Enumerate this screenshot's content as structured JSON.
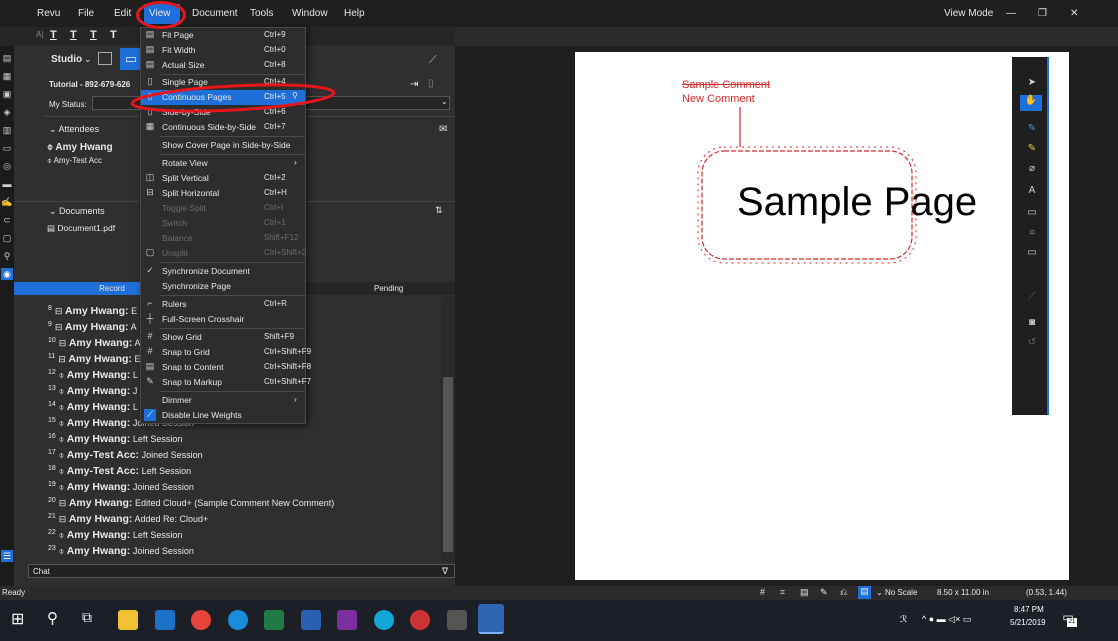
{
  "menubar": {
    "items": [
      "Revu",
      "File",
      "Edit",
      "View",
      "Document",
      "Tools",
      "Window",
      "Help"
    ],
    "view_mode": "View Mode"
  },
  "toolbar": {
    "studio_label": "Studio"
  },
  "session": {
    "id": "Tutorial - 892-679-626",
    "status_label": "My Status:"
  },
  "attendees": {
    "header": "Attendees",
    "names": [
      "Amy Hwang",
      "Amy-Test Acc"
    ]
  },
  "documents": {
    "header": "Documents",
    "items": [
      "Document1.pdf"
    ]
  },
  "record_tabs": {
    "record": "Record",
    "pending": "Pending"
  },
  "log": [
    {
      "n": "8",
      "name": "Amy Hwang:",
      "text": "E"
    },
    {
      "n": "9",
      "name": "Amy Hwang:",
      "text": "A"
    },
    {
      "n": "10",
      "name": "Amy Hwang:",
      "text": "A"
    },
    {
      "n": "11",
      "name": "Amy Hwang:",
      "text": "E"
    },
    {
      "n": "12",
      "name": "Amy Hwang:",
      "text": "L"
    },
    {
      "n": "13",
      "name": "Amy Hwang:",
      "text": "J"
    },
    {
      "n": "14",
      "name": "Amy Hwang:",
      "text": "L"
    },
    {
      "n": "15",
      "name": "Amy Hwang:",
      "text": "Joined Session"
    },
    {
      "n": "16",
      "name": "Amy Hwang:",
      "text": "Left Session"
    },
    {
      "n": "17",
      "name": "Amy-Test Acc:",
      "text": "Joined Session"
    },
    {
      "n": "18",
      "name": "Amy-Test Acc:",
      "text": "Left Session"
    },
    {
      "n": "19",
      "name": "Amy Hwang:",
      "text": "Joined Session"
    },
    {
      "n": "20",
      "name": "Amy Hwang:",
      "text": "Edited Cloud+ (Sample Comment New Comment)"
    },
    {
      "n": "21",
      "name": "Amy Hwang:",
      "text": "Added Re: Cloud+"
    },
    {
      "n": "22",
      "name": "Amy Hwang:",
      "text": "Left Session"
    },
    {
      "n": "23",
      "name": "Amy Hwang:",
      "text": "Joined Session"
    }
  ],
  "chat": {
    "label": "Chat"
  },
  "view_menu": [
    {
      "label": "Fit Page",
      "shortcut": "Ctrl+9",
      "icon": "fit-page-icon"
    },
    {
      "label": "Fit Width",
      "shortcut": "Ctrl+0",
      "icon": "fit-width-icon"
    },
    {
      "label": "Actual Size",
      "shortcut": "Ctrl+8",
      "icon": "actual-size-icon"
    },
    {
      "label": "Single Page",
      "shortcut": "Ctrl+4",
      "icon": "single-page-icon"
    },
    {
      "label": "Continuous Pages",
      "shortcut": "Ctrl+5",
      "icon": "continuous-pages-icon"
    },
    {
      "label": "Side-by-Side",
      "shortcut": "Ctrl+6",
      "icon": "side-by-side-icon"
    },
    {
      "label": "Continuous Side-by-Side",
      "shortcut": "Ctrl+7",
      "icon": "continuous-side-by-side-icon"
    },
    {
      "label": "Show Cover Page in Side-by-Side",
      "shortcut": "",
      "icon": ""
    },
    {
      "label": "Rotate View",
      "shortcut": "",
      "icon": ""
    },
    {
      "label": "Split Vertical",
      "shortcut": "Ctrl+2",
      "icon": "split-vertical-icon"
    },
    {
      "label": "Split Horizontal",
      "shortcut": "Ctrl+H",
      "icon": "split-horizontal-icon"
    },
    {
      "label": "Toggle Split",
      "shortcut": "Ctrl+I",
      "icon": ""
    },
    {
      "label": "Switch",
      "shortcut": "Ctrl+1",
      "icon": ""
    },
    {
      "label": "Balance",
      "shortcut": "Shift+F12",
      "icon": ""
    },
    {
      "label": "Unsplit",
      "shortcut": "Ctrl+Shift+2",
      "icon": "unsplit-icon"
    },
    {
      "label": "Synchronize Document",
      "shortcut": "",
      "icon": "check-icon"
    },
    {
      "label": "Synchronize Page",
      "shortcut": "",
      "icon": ""
    },
    {
      "label": "Rulers",
      "shortcut": "Ctrl+R",
      "icon": "rulers-icon"
    },
    {
      "label": "Full-Screen Crosshair",
      "shortcut": "",
      "icon": "crosshair-icon"
    },
    {
      "label": "Show Grid",
      "shortcut": "Shift+F9",
      "icon": "grid-icon"
    },
    {
      "label": "Snap to Grid",
      "shortcut": "Ctrl+Shift+F9",
      "icon": "snap-grid-icon"
    },
    {
      "label": "Snap to Content",
      "shortcut": "Ctrl+Shift+F8",
      "icon": "snap-content-icon"
    },
    {
      "label": "Snap to Markup",
      "shortcut": "Ctrl+Shift+F7",
      "icon": "snap-markup-icon"
    },
    {
      "label": "Dimmer",
      "shortcut": "",
      "icon": ""
    },
    {
      "label": "Disable Line Weights",
      "shortcut": "",
      "icon": "line-weights-icon"
    }
  ],
  "document": {
    "comment_line1": "Sample Comment",
    "comment_line2": "New Comment",
    "page_text": "Sample Page"
  },
  "status": {
    "left": "Ready",
    "scale": "No Scale",
    "size": "8.50 x 11.00 in",
    "coords": "(0.53, 1.44)"
  },
  "taskbar": {
    "time": "8:47 PM",
    "date": "5/21/2019",
    "badge": "21"
  },
  "colors": {
    "accent": "#1e6fd9",
    "annotation_red": "#e3171c",
    "comment_red": "#d42a2a",
    "highlight_circle": "#e3171c"
  }
}
